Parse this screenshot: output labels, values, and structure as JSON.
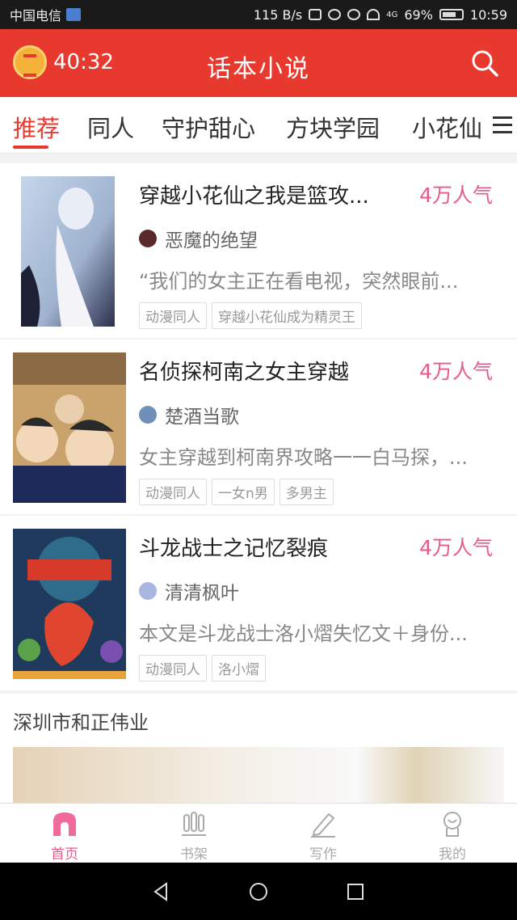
{
  "status_bar": {
    "carrier": "中国电信",
    "speed": "115 B/s",
    "network": "4G",
    "battery": "69%",
    "time": "10:59"
  },
  "app_bar": {
    "timer": "40:32",
    "title": "话本小说"
  },
  "tabs": [
    "推荐",
    "同人",
    "守护甜心",
    "方块学园",
    "小花仙"
  ],
  "active_tab": "推荐",
  "cards": [
    {
      "title": "穿越小花仙之我是篮攻...",
      "popularity": "4万人气",
      "author": "恶魔的绝望",
      "summary": "“我们的女主正在看电视，突然眼前...",
      "tags": [
        "动漫同人",
        "穿越小花仙成为精灵王"
      ]
    },
    {
      "title": "名侦探柯南之女主穿越",
      "popularity": "4万人气",
      "author": "楚酒当歌",
      "summary": "女主穿越到柯南界攻略一一白马探，...",
      "tags": [
        "动漫同人",
        "一女n男",
        "多男主"
      ]
    },
    {
      "title": "斗龙战士之记忆裂痕",
      "popularity": "4万人气",
      "author": "清清枫叶",
      "summary": "本文是斗龙战士洛小熠失忆文＋身份...",
      "tags": [
        "动漫同人",
        "洛小熠"
      ]
    }
  ],
  "ad": {
    "title": "深圳市和正伟业"
  },
  "bottom_nav": [
    {
      "label": "首页",
      "icon": "home-icon",
      "active": true
    },
    {
      "label": "书架",
      "icon": "bookshelf-icon",
      "active": false
    },
    {
      "label": "写作",
      "icon": "pencil-icon",
      "active": false
    },
    {
      "label": "我的",
      "icon": "profile-icon",
      "active": false
    }
  ],
  "colors": {
    "primary": "#e8392f",
    "accent_pink": "#e85a8c"
  }
}
